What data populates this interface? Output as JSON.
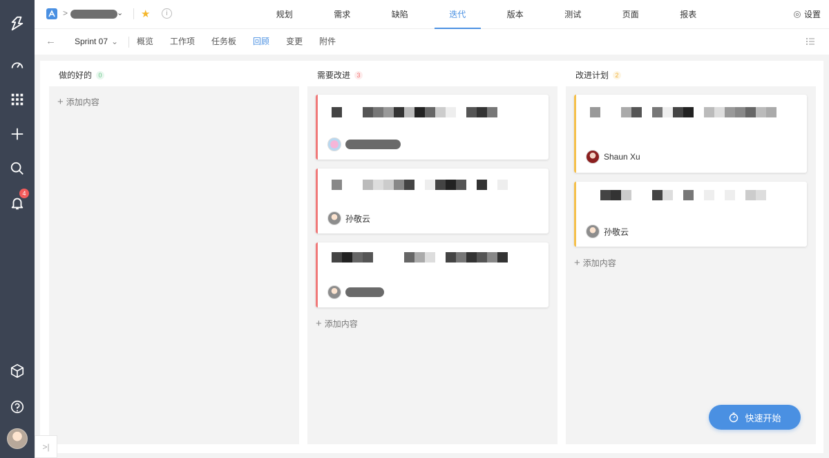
{
  "header": {
    "nav": [
      "规划",
      "需求",
      "缺陷",
      "迭代",
      "版本",
      "测试",
      "页面",
      "报表"
    ],
    "active_nav": "迭代",
    "settings_label": "设置",
    "info_glyph": "i"
  },
  "subheader": {
    "sprint_label": "Sprint 07",
    "tabs": [
      "概览",
      "工作项",
      "任务板",
      "回顾",
      "变更",
      "附件"
    ],
    "active_tab": "回顾"
  },
  "sidebar": {
    "notification_count": "4",
    "icons": [
      "logo-icon",
      "dashboard-icon",
      "apps-grid-icon",
      "plus-icon",
      "search-icon",
      "bell-icon",
      "cube-icon",
      "help-icon"
    ]
  },
  "columns": [
    {
      "title": "做的好的",
      "count": "0",
      "color": "#6cc68b",
      "add_label": "添加内容"
    },
    {
      "title": "需要改进",
      "count": "3",
      "color": "#f27373",
      "add_label": "添加内容"
    },
    {
      "title": "改进计划",
      "count": "2",
      "color": "#f0b13a",
      "add_label": "添加内容"
    }
  ],
  "cards": {
    "col2": [
      {
        "user": ""
      },
      {
        "user": "孙敬云"
      },
      {
        "user": ""
      }
    ],
    "col3": [
      {
        "user": "Shaun Xu"
      },
      {
        "user": "孙敬云"
      }
    ]
  },
  "quick_start_label": "快速开始",
  "colors": {
    "accent": "#4a90e2",
    "sidebar": "#3c4453",
    "danger": "#f25b5b"
  }
}
